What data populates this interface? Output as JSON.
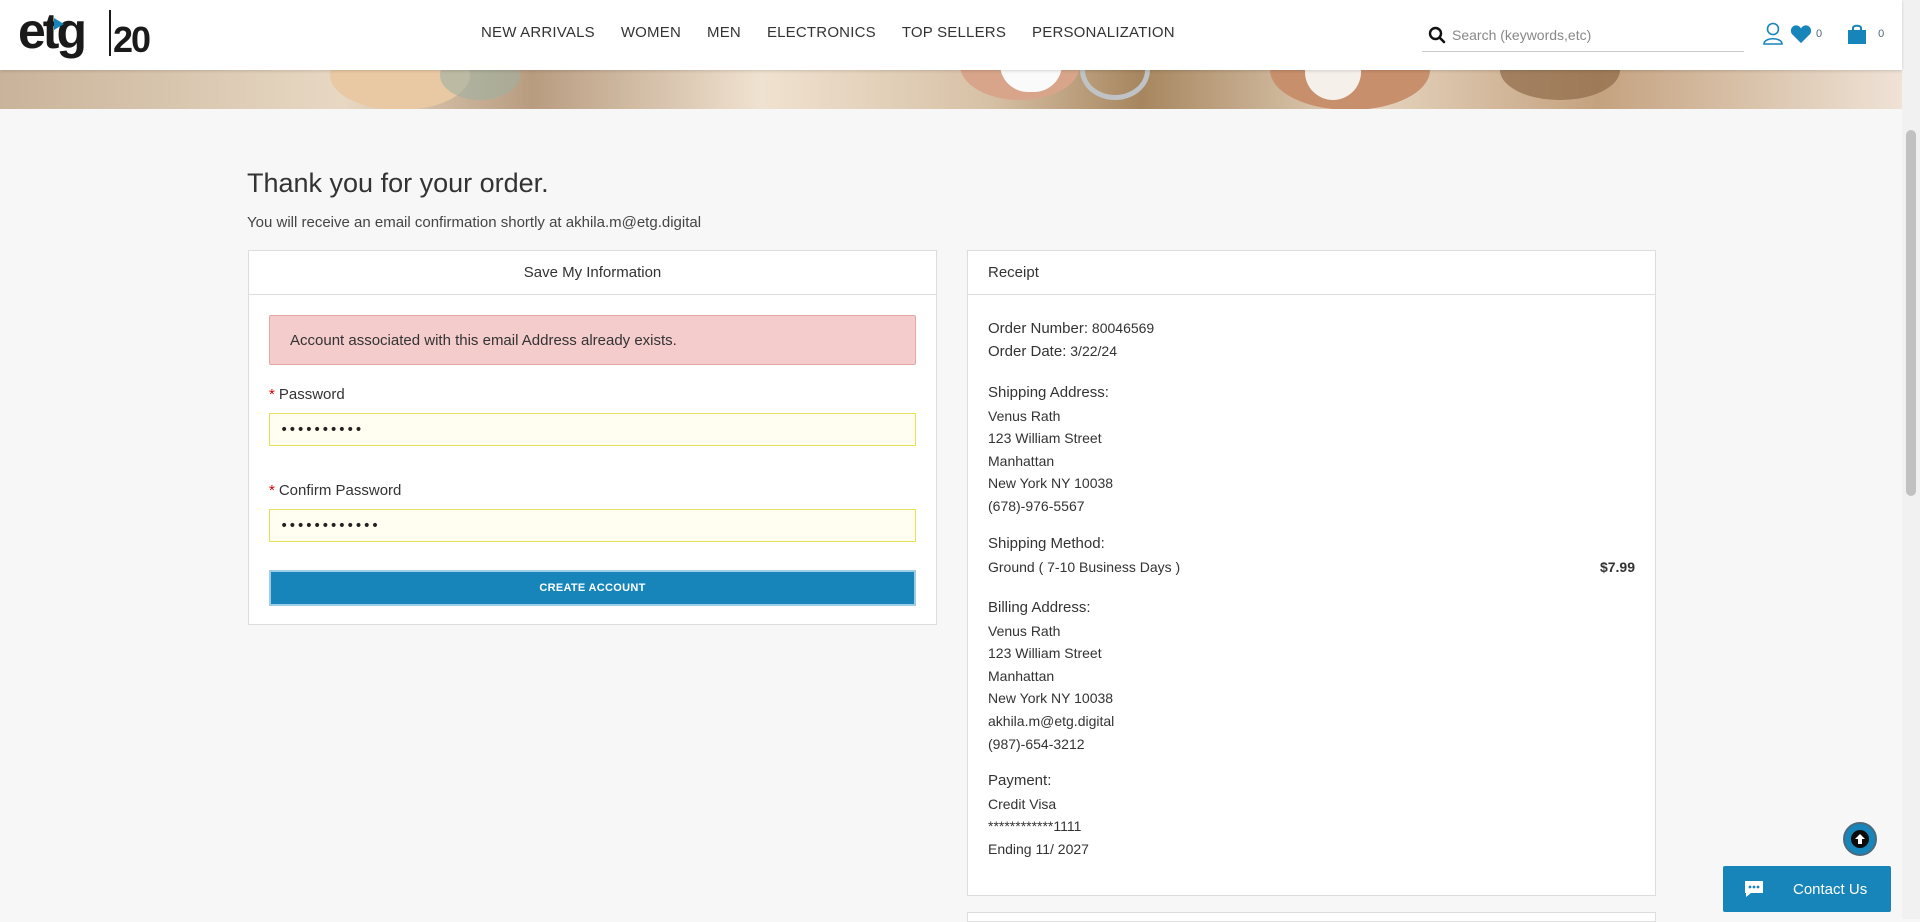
{
  "header": {
    "logo_text": "etg",
    "logo_badge": "20",
    "nav": [
      "NEW ARRIVALS",
      "WOMEN",
      "MEN",
      "ELECTRONICS",
      "TOP SELLERS",
      "PERSONALIZATION"
    ],
    "search_placeholder": "Search (keywords,etc)",
    "wishlist_count": "0",
    "cart_count": "0"
  },
  "page": {
    "title": "Thank you for your order.",
    "subtitle": "You will receive an email confirmation shortly at akhila.m@etg.digital"
  },
  "save_info": {
    "heading": "Save My Information",
    "alert": "Account associated with this email Address already exists.",
    "password_label": "Password",
    "password_value": "••••••••••",
    "confirm_label": "Confirm Password",
    "confirm_value": "••••••••••••",
    "required_marker": "*",
    "create_button": "CREATE ACCOUNT"
  },
  "receipt": {
    "heading": "Receipt",
    "order_number_label": "Order Number:",
    "order_number": "80046569",
    "order_date_label": "Order Date:",
    "order_date": "3/22/24",
    "shipping_address_label": "Shipping Address:",
    "shipping_address": [
      "Venus Rath",
      "123 William Street",
      "Manhattan",
      "New York NY 10038",
      "(678)-976-5567"
    ],
    "shipping_method_label": "Shipping Method:",
    "shipping_method": "Ground ( 7-10 Business Days )",
    "shipping_price": "$7.99",
    "billing_address_label": "Billing Address:",
    "billing_address": [
      "Venus Rath",
      "123 William Street",
      "Manhattan",
      "New York NY 10038",
      "akhila.m@etg.digital",
      "(987)-654-3212"
    ],
    "payment_label": "Payment:",
    "payment": [
      "Credit Visa",
      "************1111",
      "Ending 11/ 2027"
    ]
  },
  "widgets": {
    "contact_label": "Contact Us"
  },
  "colors": {
    "accent": "#1785ba",
    "alert_bg": "#f4cccc",
    "field_border": "#e6e05a"
  }
}
